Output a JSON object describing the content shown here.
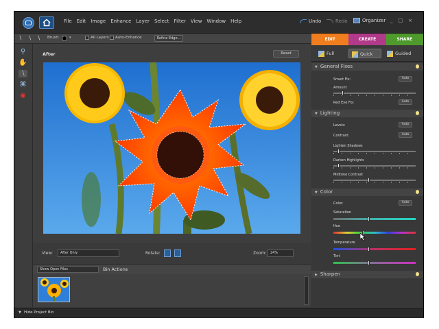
{
  "menubar": {
    "menus": [
      "File",
      "Edit",
      "Image",
      "Enhance",
      "Layer",
      "Select",
      "Filter",
      "View",
      "Window",
      "Help"
    ],
    "undo": "Undo",
    "redo": "Redo",
    "organizer": "Organizer",
    "window_controls": [
      "_",
      "□",
      "×"
    ]
  },
  "optionsbar": {
    "brush_label": "Brush:",
    "all_layers": "All Layers",
    "auto_enhance": "Auto-Enhance",
    "refine_edge": "Refine Edge..."
  },
  "document": {
    "title": "After",
    "reset": "Reset"
  },
  "viewbar": {
    "view_label": "View:",
    "view_value": "After Only",
    "rotate_label": "Rotate:",
    "zoom_label": "Zoom:",
    "zoom_value": "24%"
  },
  "projectbin": {
    "dropdown": "Show Open Files",
    "actions": "Bin Actions",
    "hide_label": "Hide Project Bin"
  },
  "panel": {
    "modes": [
      "EDIT",
      "CREATE",
      "SHARE"
    ],
    "mode_colors": [
      "#f07e1e",
      "#b23a8a",
      "#4f9a2c"
    ],
    "subtabs": [
      "Full",
      "Quick",
      "Guided"
    ],
    "general_fixes": {
      "title": "General Fixes",
      "smart_fix": "Smart Fix:",
      "amount": "Amount",
      "red_eye_fix": "Red Eye Fix:",
      "auto": "Auto",
      "amount_level": 0.1
    },
    "lighting": {
      "title": "Lighting",
      "levels": "Levels:",
      "contrast": "Contrast:",
      "lighten_shadows": "Lighten Shadows",
      "darken_highlights": "Darken Highlights",
      "midtone_contrast": "Midtone Contrast",
      "auto": "Auto",
      "lighten_shadows_level": 0.05,
      "darken_highlights_level": 0.05,
      "midtone_contrast_level": 0.42
    },
    "color": {
      "title": "Color",
      "color": "Color:",
      "saturation": "Saturation",
      "hue": "Hue",
      "temperature": "Temperature",
      "tint": "Tint",
      "auto": "Auto",
      "saturation_level": 0.42,
      "hue_level": 0.35,
      "temperature_level": 0.42,
      "tint_level": 0.42
    },
    "sharpen": {
      "title": "Sharpen"
    }
  }
}
